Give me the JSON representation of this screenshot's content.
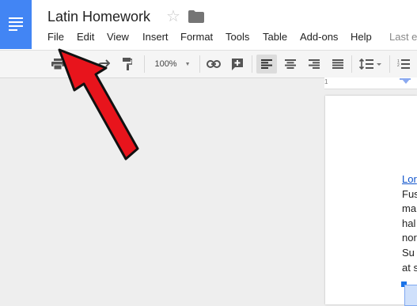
{
  "document": {
    "title": "Latin Homework"
  },
  "menu": {
    "items": [
      "File",
      "Edit",
      "View",
      "Insert",
      "Format",
      "Tools",
      "Table",
      "Add-ons",
      "Help"
    ],
    "last_edit": "Last e"
  },
  "toolbar": {
    "zoom": "100%",
    "icons": [
      "print-icon",
      "undo-icon",
      "redo-icon",
      "paint-format-icon",
      "zoom-select",
      "link-icon",
      "add-comment-icon",
      "align-left-icon",
      "align-center-icon",
      "align-right-icon",
      "justify-icon",
      "line-spacing-icon",
      "numbered-list-icon"
    ],
    "active_alignment": "left"
  },
  "ruler": {
    "number": "1"
  },
  "page": {
    "lines": [
      "Lor",
      "Fus",
      "ma",
      "hal",
      "nor",
      "Su",
      "at s"
    ],
    "link_line_index": 0
  },
  "colors": {
    "brand_blue": "#4285f4",
    "annotation_arrow": "#e8141c",
    "link": "#1155cc"
  }
}
